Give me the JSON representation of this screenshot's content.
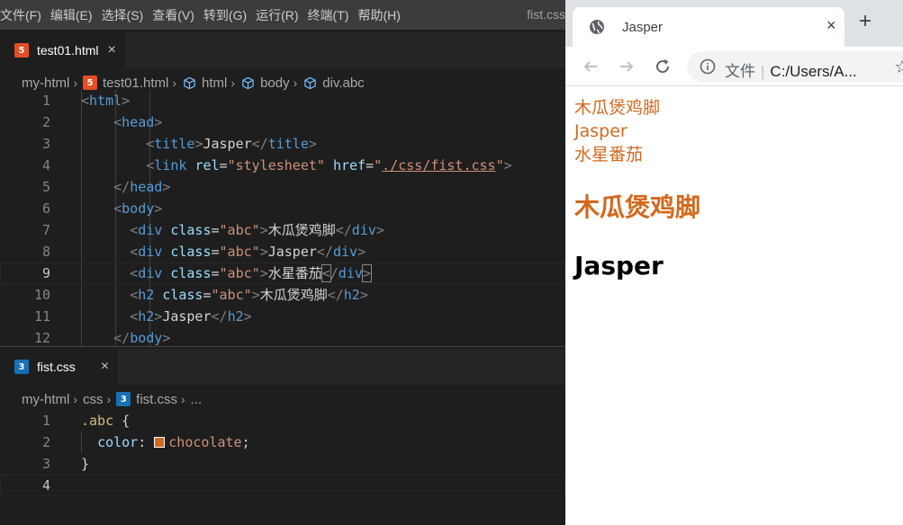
{
  "menubar": {
    "items": [
      "文件(F)",
      "编辑(E)",
      "选择(S)",
      "查看(V)",
      "转到(G)",
      "运行(R)",
      "终端(T)",
      "帮助(H)"
    ],
    "window_title": "fist.css"
  },
  "top_pane": {
    "tab": {
      "label": "test01.html",
      "icon": "html5-file-icon",
      "close": "×"
    },
    "breadcrumb": [
      "my-html",
      "test01.html",
      "html",
      "body",
      "div.abc"
    ],
    "line_numbers": [
      "1",
      "2",
      "3",
      "4",
      "5",
      "6",
      "7",
      "8",
      "9",
      "10",
      "11",
      "12"
    ],
    "active_line": "9"
  },
  "bottom_pane": {
    "tab": {
      "label": "fist.css",
      "icon": "css3-file-icon",
      "close": "×"
    },
    "breadcrumb": [
      "my-html",
      "css",
      "fist.css",
      "..."
    ],
    "line_numbers": [
      "1",
      "2",
      "3",
      "4"
    ],
    "active_line": "4",
    "swatch_color": "#d2691e"
  },
  "browser": {
    "tab_title": "Jasper",
    "tab_close": "×",
    "new_tab": "+",
    "address_label": "文件",
    "address_url": "C:/Users/A...",
    "page": {
      "divs": [
        "木瓜煲鸡脚",
        "Jasper",
        "水星番茄"
      ],
      "h2_abc": "木瓜煲鸡脚",
      "h2_plain": "Jasper",
      "abc_color": "#d2691e"
    }
  }
}
